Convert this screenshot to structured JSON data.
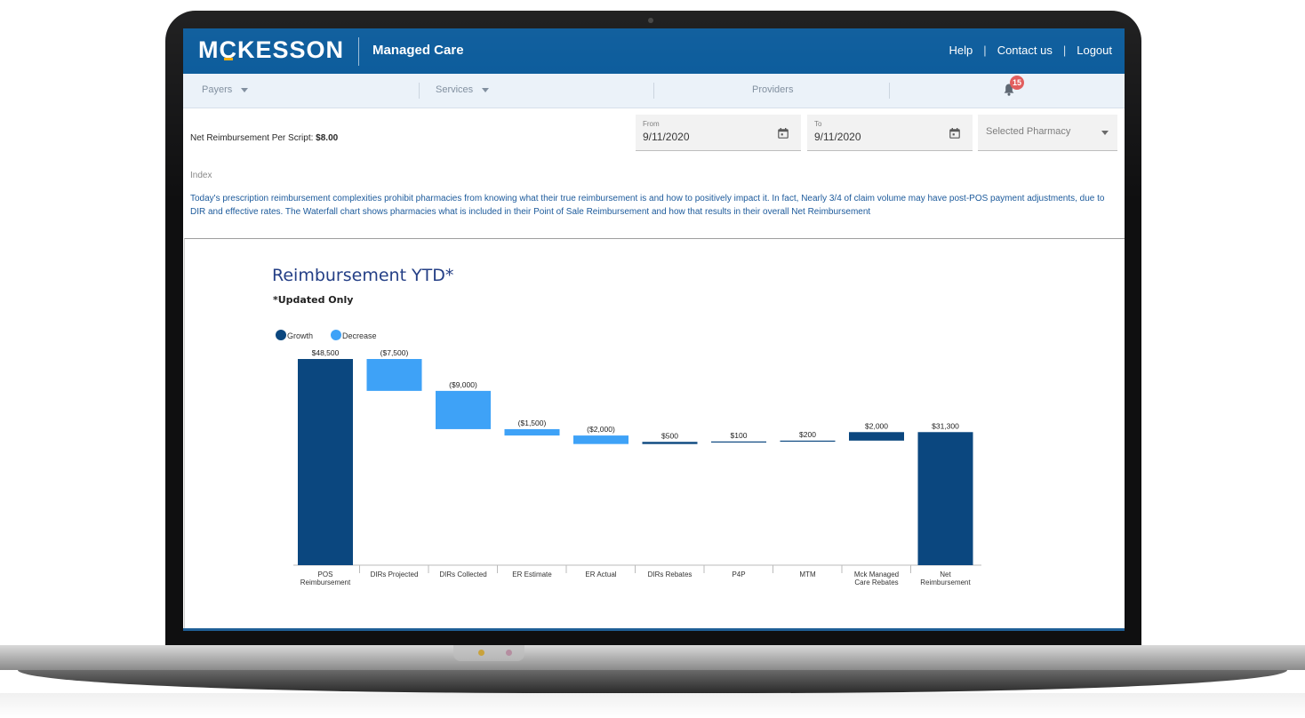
{
  "header": {
    "logo": "MCKESSON",
    "app_name": "Managed Care",
    "links": [
      "Help",
      "Contact us",
      "Logout"
    ]
  },
  "nav": {
    "items": [
      "Payers",
      "Services",
      "Providers"
    ],
    "notification_count": "15"
  },
  "filters": {
    "net_label": "Net Reimbursement Per Script: ",
    "net_value": "$8.00",
    "from_label": "From",
    "from_value": "9/11/2020",
    "to_label": "To",
    "to_value": "9/11/2020",
    "pharmacy_value": "Selected Pharmacy"
  },
  "index": {
    "label": "Index",
    "text": "Today's prescription reimbursement complexities prohibit pharmacies from knowing what their true reimbursement is and how to positively impact it. In fact, Nearly 3/4 of claim volume may have post-POS payment adjustments, due to DIR and effective rates. The Waterfall chart shows pharmacies what is included in their Point of Sale Reimbursement and how that results in their overall Net Reimbursement"
  },
  "colors": {
    "brand": "#005497",
    "growth": "#0b477f",
    "decrease": "#3ea2f7"
  },
  "chart_data": {
    "type": "bar",
    "title": "Reimbursement YTD*",
    "subtitle": "*Updated Only",
    "legend": [
      "Growth",
      "Decrease"
    ],
    "legend_position": "top-left",
    "categories": [
      "POS Reimbursement",
      "DIRs Projected",
      "DIRs Collected",
      "ER Estimate",
      "ER Actual",
      "DIRs Rebates",
      "P4P",
      "MTM",
      "Mck Managed Care Rebates",
      "Net Reimbursement"
    ],
    "values": [
      48500,
      -7500,
      -9000,
      -1500,
      -2000,
      500,
      100,
      200,
      2000,
      31300
    ],
    "labels": [
      "$48,500",
      "($7,500)",
      "($9,000)",
      "($1,500)",
      "($2,000)",
      "$500",
      "$100",
      "$200",
      "$2,000",
      "$31,300"
    ],
    "kinds": [
      "total",
      "decrease",
      "decrease",
      "decrease",
      "decrease",
      "growth",
      "growth",
      "growth",
      "growth",
      "total"
    ],
    "ylim": [
      0,
      48500
    ],
    "grid": false
  }
}
